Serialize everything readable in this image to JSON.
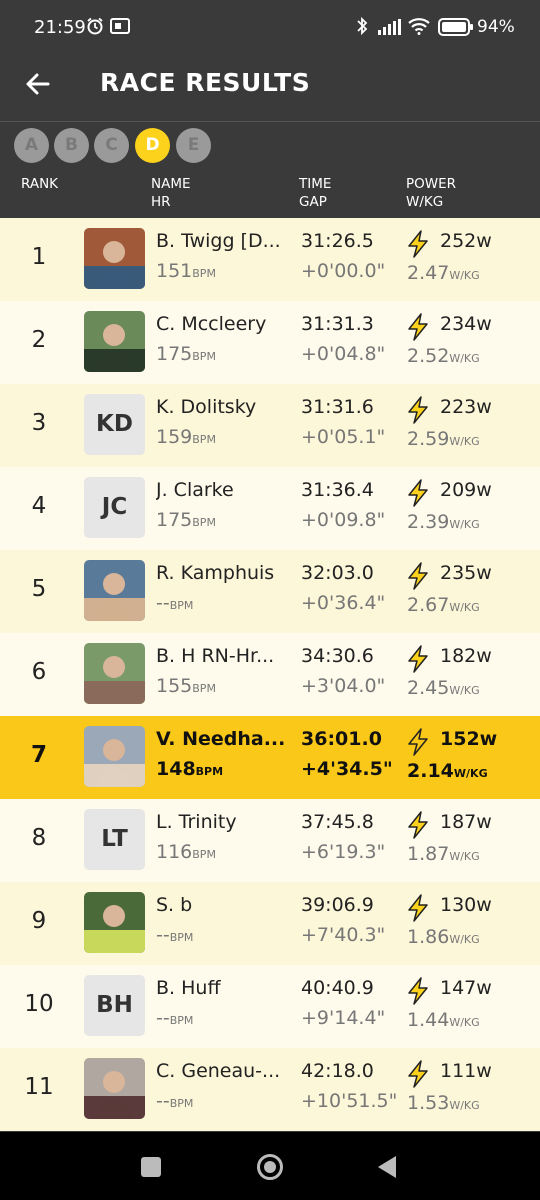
{
  "status_bar": {
    "time": "21:59",
    "battery": "94%"
  },
  "header": {
    "title": "RACE RESULTS",
    "back_icon": "arrow-left-icon"
  },
  "categories": [
    {
      "label": "A",
      "active": false
    },
    {
      "label": "B",
      "active": false
    },
    {
      "label": "C",
      "active": false
    },
    {
      "label": "D",
      "active": true
    },
    {
      "label": "E",
      "active": false
    }
  ],
  "columns": {
    "rank": "RANK",
    "name": "NAME",
    "hr": "HR",
    "time": "TIME",
    "gap": "GAP",
    "power": "POWER",
    "wkg": "W/KG"
  },
  "units": {
    "bpm": "BPM",
    "wkg": "W/KG"
  },
  "colors": {
    "accent": "#fcd21c",
    "highlight_row": "#f9c819",
    "row_light": "#fefbec",
    "row_alt": "#fdf7d9",
    "header_bg": "#3a3a3a"
  },
  "results": [
    {
      "rank": "1",
      "name": "B. Twigg [D...",
      "hr": "151",
      "time": "31:26.5",
      "gap": "+0'00.0\"",
      "watts": "252w",
      "wkg": "2.47",
      "avatar": "photo",
      "initials": ""
    },
    {
      "rank": "2",
      "name": "C. Mccleery",
      "hr": "175",
      "time": "31:31.3",
      "gap": "+0'04.8\"",
      "watts": "234w",
      "wkg": "2.52",
      "avatar": "photo",
      "initials": ""
    },
    {
      "rank": "3",
      "name": "K. Dolitsky",
      "hr": "159",
      "time": "31:31.6",
      "gap": "+0'05.1\"",
      "watts": "223w",
      "wkg": "2.59",
      "avatar": "initials",
      "initials": "KD"
    },
    {
      "rank": "4",
      "name": "J. Clarke",
      "hr": "175",
      "time": "31:36.4",
      "gap": "+0'09.8\"",
      "watts": "209w",
      "wkg": "2.39",
      "avatar": "initials",
      "initials": "JC"
    },
    {
      "rank": "5",
      "name": "R. Kamphuis",
      "hr": "--",
      "time": "32:03.0",
      "gap": "+0'36.4\"",
      "watts": "235w",
      "wkg": "2.67",
      "avatar": "photo",
      "initials": ""
    },
    {
      "rank": "6",
      "name": "B. H RN-Hr...",
      "hr": "155",
      "time": "34:30.6",
      "gap": "+3'04.0\"",
      "watts": "182w",
      "wkg": "2.45",
      "avatar": "photo",
      "initials": ""
    },
    {
      "rank": "7",
      "name": "V. Needha...",
      "hr": "148",
      "time": "36:01.0",
      "gap": "+4'34.5\"",
      "watts": "152w",
      "wkg": "2.14",
      "avatar": "photo",
      "initials": "",
      "me": true
    },
    {
      "rank": "8",
      "name": "L. Trinity",
      "hr": "116",
      "time": "37:45.8",
      "gap": "+6'19.3\"",
      "watts": "187w",
      "wkg": "1.87",
      "avatar": "initials",
      "initials": "LT"
    },
    {
      "rank": "9",
      "name": "S.  b",
      "hr": "--",
      "time": "39:06.9",
      "gap": "+7'40.3\"",
      "watts": "130w",
      "wkg": "1.86",
      "avatar": "photo",
      "initials": ""
    },
    {
      "rank": "10",
      "name": "B. Huff",
      "hr": "--",
      "time": "40:40.9",
      "gap": "+9'14.4\"",
      "watts": "147w",
      "wkg": "1.44",
      "avatar": "initials",
      "initials": "BH"
    },
    {
      "rank": "11",
      "name": "C. Geneau-...",
      "hr": "--",
      "time": "42:18.0",
      "gap": "+10'51.5\"",
      "watts": "111w",
      "wkg": "1.53",
      "avatar": "photo",
      "initials": ""
    }
  ]
}
